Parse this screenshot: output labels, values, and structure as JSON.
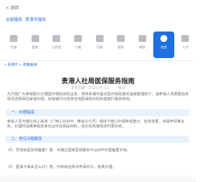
{
  "header": {
    "back_label": "< 返回",
    "breadcrumb": [
      "全部服务",
      "贵港市服务"
    ]
  },
  "toolbar": {
    "items": [
      {
        "label": "社保",
        "icon": "building-icon"
      },
      {
        "label": "医保",
        "icon": "hospital-icon"
      },
      {
        "label": "公积金",
        "icon": "house-icon"
      },
      {
        "label": "户籍",
        "icon": "id-card-icon"
      },
      {
        "label": "交通",
        "icon": "car-icon"
      },
      {
        "label": "教育",
        "icon": "book-icon"
      },
      {
        "label": "婚育",
        "icon": "heart-icon"
      },
      {
        "label": "住房",
        "icon": "home-icon"
      },
      {
        "label": "人才",
        "icon": "person-icon"
      }
    ],
    "active_index": 7,
    "accent": "#1f6fe0"
  },
  "location": "• 贵港市 > 政策解读",
  "article": {
    "title": "贵港人社局医保服务指南",
    "meta": [
      "发布日期：2023-05-12",
      "来源"
    ],
    "intro": "为方便广大参保群众办理医疗保险相关业务，现将贵港市基本医疗保险服务指南整理如下，请参保人员根据自身情况选择相应渠道办理，如有疑问可咨询当地医保经办机构或拨打服务热线。",
    "section1_title": "一、办理指南",
    "section1_body": "参保人员可通过线上渠道（广西人社APP、微信公众号）或线下窗口办理参保登记、信息变更、待遇申领等业务，办理时请携带有效身份证件及相关材料，经办机构按规定时限办结。",
    "section2_title": "二、常见问题解答",
    "qa1": "问：异地就医如何备案？答：可通过国家医保服务平台APP办理备案手续。",
    "qa2": "问：医保卡丢失怎么办？答：可到就近网点申请补办，免费办理。"
  }
}
